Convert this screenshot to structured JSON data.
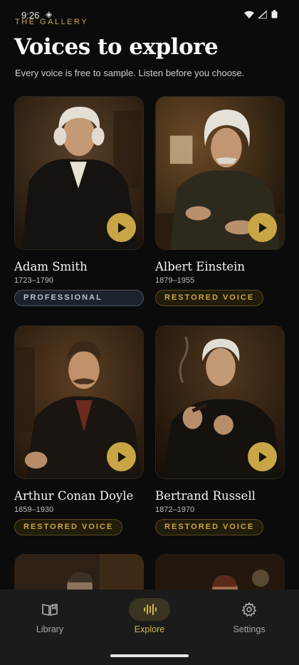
{
  "status": {
    "time": "9:26",
    "extra_glyph": "◈"
  },
  "header": {
    "eyebrow": "THE GALLERY",
    "title": "Voices to explore",
    "subtitle": "Every voice is free to sample. Listen before you choose."
  },
  "voices": [
    {
      "name": "Adam Smith",
      "years": "1723–1790",
      "badge": "PROFESSIONAL"
    },
    {
      "name": "Albert Einstein",
      "years": "1879–1955",
      "badge": "RESTORED VOICE"
    },
    {
      "name": "Arthur Conan Doyle",
      "years": "1859–1930",
      "badge": "RESTORED VOICE"
    },
    {
      "name": "Bertrand Russell",
      "years": "1872–1970",
      "badge": "RESTORED VOICE"
    }
  ],
  "nav": {
    "items": [
      {
        "label": "Library",
        "icon": "book-icon"
      },
      {
        "label": "Explore",
        "icon": "waveform-icon",
        "active": true
      },
      {
        "label": "Settings",
        "icon": "gear-icon"
      }
    ]
  },
  "colors": {
    "accent": "#c8a646",
    "background": "#0b0b0b",
    "tabbar": "#1b1b1b"
  }
}
